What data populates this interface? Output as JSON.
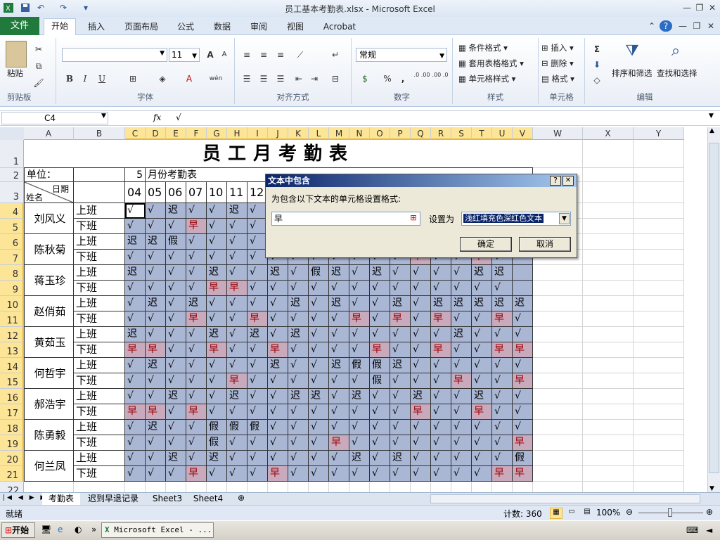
{
  "window": {
    "title": "员工基本考勤表.xlsx - Microsoft Excel"
  },
  "ribbon_tabs": [
    "文件",
    "开始",
    "插入",
    "页面布局",
    "公式",
    "数据",
    "审阅",
    "视图",
    "Acrobat"
  ],
  "ribbon": {
    "clipboard": {
      "paste": "粘贴",
      "label": "剪贴板"
    },
    "font": {
      "size": "11",
      "label": "字体",
      "bold": "B",
      "italic": "I",
      "underline": "U",
      "grow": "A",
      "shrink": "A",
      "color_a": "A",
      "wen": "wén"
    },
    "alignment": {
      "label": "对齐方式"
    },
    "number": {
      "format": "常规",
      "label": "数字",
      "percent": "%",
      "comma": ",",
      "inc": ".0 .00",
      "dec": ".00 .0"
    },
    "styles": {
      "cond": "条件格式",
      "table": "套用表格格式",
      "cell": "单元格样式",
      "label": "样式"
    },
    "cells": {
      "insert": "插入",
      "delete": "删除",
      "format": "格式",
      "label": "单元格"
    },
    "editing": {
      "sort": "排序和筛选",
      "find": "查找和选择",
      "label": "编辑",
      "sigma": "Σ"
    }
  },
  "formula_bar": {
    "name_box": "C4",
    "fx": "fx",
    "value": "√"
  },
  "columns": [
    "A",
    "B",
    "C",
    "D",
    "E",
    "F",
    "G",
    "H",
    "I",
    "J",
    "K",
    "L",
    "M",
    "N",
    "O",
    "P",
    "Q",
    "R",
    "S",
    "T",
    "U",
    "V",
    "W",
    "X",
    "Y"
  ],
  "sheet": {
    "title": "员工月考勤表",
    "unit_label": "单位：",
    "month_num": "5",
    "month_label": "月份考勤表",
    "header_date": "日期",
    "header_name": "姓名",
    "dates": [
      "04",
      "05",
      "06",
      "07",
      "10",
      "11",
      "12"
    ],
    "shift_labels": [
      "上班",
      "下班"
    ],
    "employees": [
      {
        "name": "刘风义",
        "rows": [
          [
            "√",
            "√",
            "迟",
            "√",
            "√",
            "迟",
            "√"
          ],
          [
            "√",
            "√",
            "√",
            "早",
            "√",
            "√",
            "√"
          ]
        ]
      },
      {
        "name": "陈秋菊",
        "rows": [
          [
            "迟",
            "迟",
            "假",
            "√",
            "√",
            "√",
            "√"
          ],
          [
            "√",
            "√",
            "√",
            "√",
            "√",
            "√",
            "√",
            "√",
            "√",
            "√",
            "√",
            "√",
            "√",
            "√",
            "早",
            "√",
            "√",
            "早",
            "√"
          ]
        ]
      },
      {
        "name": "蒋玉珍",
        "rows": [
          [
            "迟",
            "√",
            "√",
            "√",
            "迟",
            "√",
            "√",
            "迟",
            "√",
            "假",
            "迟",
            "√",
            "迟",
            "√",
            "√",
            "√",
            "√",
            "迟",
            "迟"
          ],
          [
            "√",
            "√",
            "√",
            "√",
            "早",
            "早",
            "√",
            "√",
            "√",
            "√",
            "√",
            "√",
            "√",
            "√",
            "√",
            "√",
            "√",
            "√",
            "√"
          ]
        ]
      },
      {
        "name": "赵俏茹",
        "rows": [
          [
            "√",
            "迟",
            "√",
            "迟",
            "√",
            "√",
            "√",
            "√",
            "迟",
            "√",
            "迟",
            "√",
            "√",
            "迟",
            "√",
            "迟",
            "迟",
            "迟",
            "迟",
            "迟"
          ],
          [
            "√",
            "√",
            "√",
            "早",
            "√",
            "√",
            "早",
            "√",
            "√",
            "√",
            "√",
            "早",
            "√",
            "早",
            "√",
            "早",
            "√",
            "√",
            "早",
            "√"
          ]
        ]
      },
      {
        "name": "黄茹玉",
        "rows": [
          [
            "迟",
            "√",
            "√",
            "√",
            "迟",
            "√",
            "迟",
            "√",
            "迟",
            "√",
            "√",
            "√",
            "√",
            "√",
            "√",
            "√",
            "迟",
            "√",
            "√",
            "√"
          ],
          [
            "早",
            "早",
            "√",
            "√",
            "早",
            "√",
            "√",
            "早",
            "√",
            "√",
            "√",
            "√",
            "早",
            "√",
            "√",
            "早",
            "√",
            "√",
            "早",
            "早"
          ]
        ]
      },
      {
        "name": "何哲宇",
        "rows": [
          [
            "√",
            "迟",
            "√",
            "√",
            "√",
            "√",
            "√",
            "迟",
            "√",
            "√",
            "迟",
            "假",
            "假",
            "迟",
            "√",
            "√",
            "√",
            "√",
            "√",
            "√"
          ],
          [
            "√",
            "√",
            "√",
            "√",
            "√",
            "早",
            "√",
            "√",
            "√",
            "√",
            "√",
            "√",
            "假",
            "√",
            "√",
            "√",
            "早",
            "√",
            "√",
            "早"
          ]
        ]
      },
      {
        "name": "郝浩宇",
        "rows": [
          [
            "√",
            "√",
            "迟",
            "√",
            "√",
            "迟",
            "√",
            "√",
            "迟",
            "迟",
            "√",
            "迟",
            "√",
            "√",
            "迟",
            "√",
            "√",
            "迟",
            "√",
            "√"
          ],
          [
            "早",
            "早",
            "√",
            "早",
            "√",
            "√",
            "√",
            "√",
            "√",
            "√",
            "√",
            "√",
            "√",
            "√",
            "早",
            "√",
            "√",
            "早",
            "√",
            "√"
          ]
        ]
      },
      {
        "name": "陈勇毅",
        "rows": [
          [
            "√",
            "迟",
            "√",
            "√",
            "假",
            "假",
            "假",
            "√",
            "√",
            "√",
            "√",
            "√",
            "√",
            "√",
            "√",
            "√",
            "√",
            "√",
            "√",
            "√"
          ],
          [
            "√",
            "√",
            "√",
            "√",
            "假",
            "√",
            "√",
            "√",
            "√",
            "√",
            "早",
            "√",
            "√",
            "√",
            "√",
            "√",
            "√",
            "√",
            "√",
            "早"
          ]
        ]
      },
      {
        "name": "何兰凤",
        "rows": [
          [
            "√",
            "√",
            "迟",
            "√",
            "迟",
            "√",
            "√",
            "√",
            "√",
            "√",
            "√",
            "迟",
            "√",
            "迟",
            "√",
            "√",
            "√",
            "√",
            "√",
            "假"
          ],
          [
            "√",
            "√",
            "√",
            "早",
            "√",
            "√",
            "√",
            "早",
            "√",
            "√",
            "√",
            "√",
            "√",
            "√",
            "√",
            "√",
            "√",
            "√",
            "早",
            "早"
          ]
        ]
      }
    ]
  },
  "dialog": {
    "title": "文本中包含",
    "help": "?",
    "close": "✕",
    "prompt": "为包含以下文本的单元格设置格式:",
    "input_value": "早",
    "set_as": "设置为",
    "format_choice": "浅红填充色深红色文本",
    "ok": "确定",
    "cancel": "取消"
  },
  "sheet_tabs": [
    "考勤表",
    "迟到早退记录",
    "Sheet3",
    "Sheet4"
  ],
  "status": {
    "ready": "就绪",
    "count": "计数: 360",
    "zoom": "100%"
  },
  "taskbar": {
    "start": "开始",
    "task": "Microsoft Excel - ..."
  }
}
